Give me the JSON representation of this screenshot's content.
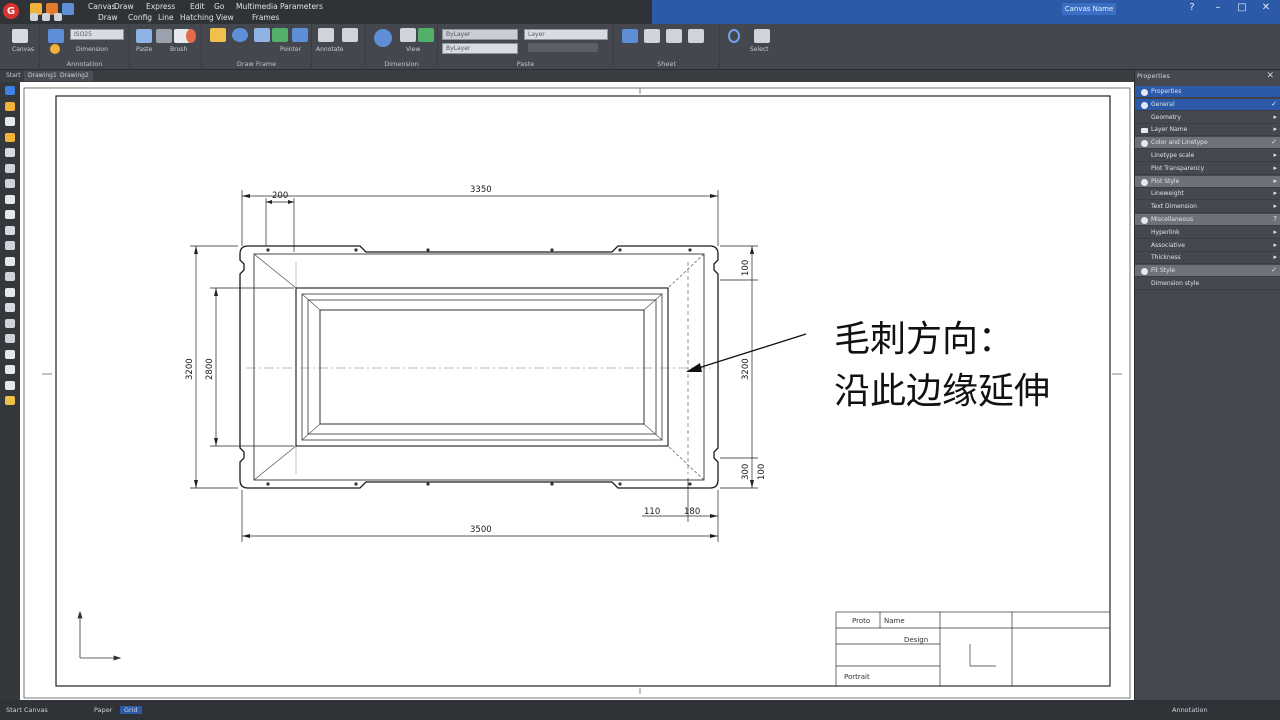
{
  "app": {
    "brand_letter": "G",
    "document_name": "Canvas Name",
    "window_controls": {
      "help": "?",
      "minimize": "–",
      "maximize": "□",
      "close": "✕"
    }
  },
  "menus": {
    "row1": [
      "Canvas",
      "Draw",
      "Express",
      "Edit",
      "Go",
      "Multimedia",
      "Parameters"
    ],
    "row2": [
      "Draw",
      "Config",
      "Line",
      "Hatching",
      "View",
      "Frames"
    ]
  },
  "ribbon": {
    "groups": [
      {
        "label": "",
        "caption": "Canvas"
      },
      {
        "label": "Annotation",
        "caption": "Dimension"
      },
      {
        "label": "",
        "caption": "Paste"
      },
      {
        "label": "",
        "caption": "Brush"
      },
      {
        "label": "Draw Frame",
        "caption": "Pointer"
      },
      {
        "label": "",
        "caption": "Annotate"
      },
      {
        "label": "Dimension",
        "caption": "View"
      },
      {
        "label": "Paste",
        "caption": ""
      },
      {
        "label": "Sheet",
        "caption": ""
      },
      {
        "label": "",
        "caption": "Select"
      }
    ],
    "fields": {
      "style": "ISO25",
      "layer1": "ByLayer",
      "layer2": "Layer",
      "layer3": "ByLayer"
    }
  },
  "tabs": [
    "Start",
    "Drawing1",
    "Drawing2"
  ],
  "drawing": {
    "dimensions": {
      "top_small": "200",
      "top_overall": "3350",
      "bottom_overall": "3500",
      "left_outer": "3200",
      "left_inner": "2800",
      "right_main": "3200",
      "right_top": "100",
      "right_bottom_a": "300",
      "right_bottom_b": "100",
      "bottom_small_a": "110",
      "bottom_small_b": "180"
    },
    "callout_line1": "毛刺方向：",
    "callout_line2": "沿此边缘延伸",
    "title_block": {
      "cell_a": "Proto",
      "cell_b": "Name",
      "cell_c": "Design",
      "cell_d": "Portrait"
    }
  },
  "properties_panel": {
    "title": "Properties",
    "rows": [
      {
        "label": "Properties",
        "marker": "dot",
        "selected": true,
        "end": ""
      },
      {
        "label": "General",
        "marker": "dot",
        "selected": true,
        "end": "✓"
      },
      {
        "label": "Geometry",
        "marker": "none",
        "selected": false,
        "end": "▸"
      },
      {
        "label": "Layer Name",
        "marker": "square",
        "selected": false,
        "end": "▸"
      },
      {
        "label": "Color and Linetype",
        "marker": "dot",
        "selected": false,
        "end": "✓"
      },
      {
        "label": "Linetype scale",
        "marker": "none",
        "selected": false,
        "end": "▸"
      },
      {
        "label": "Plot Transparency",
        "marker": "none",
        "selected": false,
        "end": "▸"
      },
      {
        "label": "Plot Style",
        "marker": "dot",
        "selected": false,
        "end": "▸"
      },
      {
        "label": "Lineweight",
        "marker": "none",
        "selected": false,
        "end": "▸"
      },
      {
        "label": "Text Dimension",
        "marker": "none",
        "selected": false,
        "end": "▸"
      },
      {
        "label": "Miscellaneous",
        "marker": "dot",
        "selected": false,
        "end": "?"
      },
      {
        "label": "Hyperlink",
        "marker": "none",
        "selected": false,
        "end": "▸"
      },
      {
        "label": "Associative",
        "marker": "none",
        "selected": false,
        "end": "▸"
      },
      {
        "label": "Thickness",
        "marker": "none",
        "selected": false,
        "end": "▸"
      },
      {
        "label": "Fit Style",
        "marker": "dot",
        "selected": false,
        "end": "✓"
      },
      {
        "label": "Dimension style",
        "marker": "none",
        "selected": false,
        "end": ""
      }
    ]
  },
  "status": {
    "coords": "Start Canvas",
    "model": "Paper",
    "mode": "Grid",
    "right": "Annotation"
  },
  "colors": {
    "accent_blue": "#2c5aa8",
    "canvas": "#ffffff",
    "ink": "#1a1a1a"
  }
}
